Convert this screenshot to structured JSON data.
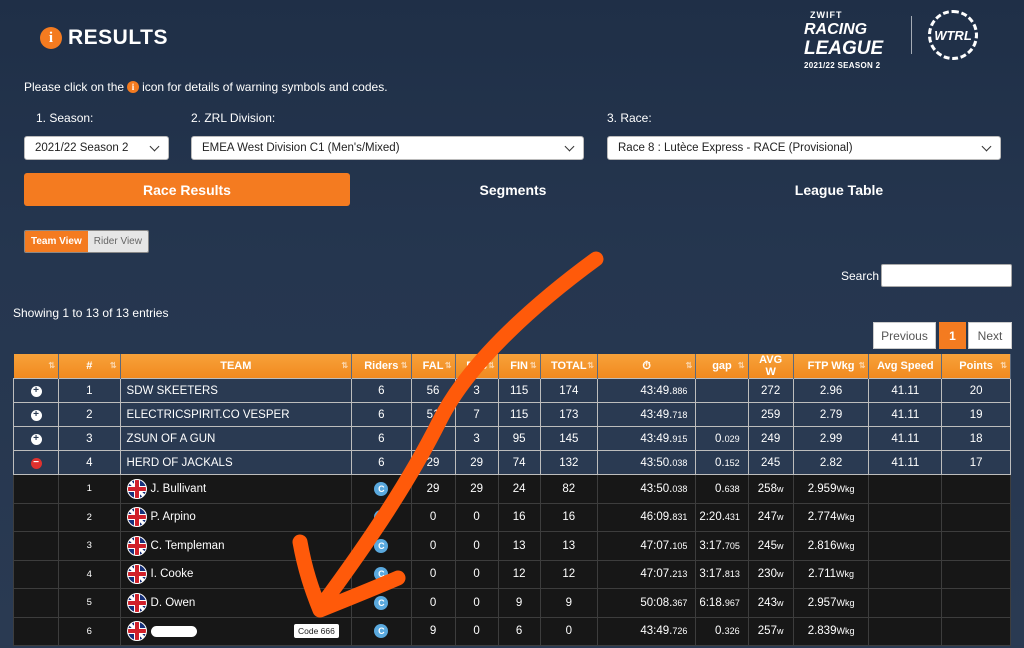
{
  "header": {
    "info_glyph": "i",
    "title": "RESULTS",
    "logo": {
      "line1": "ZWIFT",
      "line2": "RACING",
      "line3": "LEAGUE",
      "line4": "2021/22 SEASON 2"
    },
    "wtrl": "WTRL"
  },
  "notice": {
    "pre": "Please click on the",
    "post": "icon for details of warning symbols and codes."
  },
  "filters": {
    "season": {
      "label": "1. Season:",
      "value": "2021/22 Season 2"
    },
    "division": {
      "label": "2. ZRL Division:",
      "value": "EMEA West Division C1 (Men's/Mixed)"
    },
    "race": {
      "label": "3. Race:",
      "value": "Race 8 : Lutèce Express - RACE (Provisional)"
    }
  },
  "tabs": [
    "Race Results",
    "Segments",
    "League Table"
  ],
  "view": {
    "team": "Team View",
    "rider": "Rider View"
  },
  "search": {
    "label": "Search"
  },
  "showing": "Showing 1 to 13 of 13 entries",
  "pagination": {
    "previous": "Previous",
    "page": "1",
    "next": "Next"
  },
  "columns": [
    "#",
    "TEAM",
    "Riders",
    "FAL",
    "FTS",
    "FIN",
    "TOTAL",
    "⏱",
    "gap",
    "AVG W",
    "FTP Wkg",
    "Avg Speed",
    "Points"
  ],
  "teams": [
    {
      "rank": "1",
      "name": "SDW SKEETERS",
      "riders": "6",
      "fal": "56",
      "fts": "3",
      "fin": "115",
      "total": "174",
      "time": "43:49.",
      "ms": "886",
      "gap": "",
      "gap_ms": "",
      "avgw": "272",
      "ftp": "2.96",
      "speed": "41.11",
      "points": "20",
      "ctrl": "+"
    },
    {
      "rank": "2",
      "name": "ELECTRICSPIRIT.CO VESPER",
      "riders": "6",
      "fal": "51",
      "fts": "7",
      "fin": "115",
      "total": "173",
      "time": "43:49.",
      "ms": "718",
      "gap": "",
      "gap_ms": "",
      "avgw": "259",
      "ftp": "2.79",
      "speed": "41.11",
      "points": "19",
      "ctrl": "+"
    },
    {
      "rank": "3",
      "name": "ZSUN OF A GUN",
      "riders": "6",
      "fal": "47",
      "fts": "3",
      "fin": "95",
      "total": "145",
      "time": "43:49.",
      "ms": "915",
      "gap": "0.",
      "gap_ms": "029",
      "avgw": "249",
      "ftp": "2.99",
      "speed": "41.11",
      "points": "18",
      "ctrl": "+"
    },
    {
      "rank": "4",
      "name": "HERD OF JACKALS",
      "riders": "6",
      "fal": "29",
      "fts": "29",
      "fin": "74",
      "total": "132",
      "time": "43:50.",
      "ms": "038",
      "gap": "0.",
      "gap_ms": "152",
      "avgw": "245",
      "ftp": "2.82",
      "speed": "41.11",
      "points": "17",
      "ctrl": "−"
    }
  ],
  "riders": [
    {
      "rank": "1",
      "name": "J. Bullivant",
      "cat": "C",
      "fal": "29",
      "fts": "29",
      "fin": "24",
      "total": "82",
      "time": "43:50.",
      "ms": "038",
      "gap": "0.",
      "gap_ms": "638",
      "avgw": "258",
      "w": "w",
      "ftp": "2.959",
      "wkg": "Wkg"
    },
    {
      "rank": "2",
      "name": "P. Arpino",
      "cat": "C",
      "fal": "0",
      "fts": "0",
      "fin": "16",
      "total": "16",
      "time": "46:09.",
      "ms": "831",
      "gap": "2:20.",
      "gap_ms": "431",
      "avgw": "247",
      "w": "w",
      "ftp": "2.774",
      "wkg": "Wkg"
    },
    {
      "rank": "3",
      "name": "C. Templeman",
      "cat": "C",
      "fal": "0",
      "fts": "0",
      "fin": "13",
      "total": "13",
      "time": "47:07.",
      "ms": "105",
      "gap": "3:17.",
      "gap_ms": "705",
      "avgw": "245",
      "w": "w",
      "ftp": "2.816",
      "wkg": "Wkg"
    },
    {
      "rank": "4",
      "name": "I. Cooke",
      "cat": "C",
      "fal": "0",
      "fts": "0",
      "fin": "12",
      "total": "12",
      "time": "47:07.",
      "ms": "213",
      "gap": "3:17.",
      "gap_ms": "813",
      "avgw": "230",
      "w": "w",
      "ftp": "2.711",
      "wkg": "Wkg"
    },
    {
      "rank": "5",
      "name": "D. Owen",
      "cat": "C",
      "fal": "0",
      "fts": "0",
      "fin": "9",
      "total": "9",
      "time": "50:08.",
      "ms": "367",
      "gap": "6:18.",
      "gap_ms": "967",
      "avgw": "243",
      "w": "w",
      "ftp": "2.957",
      "wkg": "Wkg"
    },
    {
      "rank": "6",
      "name": "",
      "cat": "C",
      "fal": "9",
      "fts": "0",
      "fin": "6",
      "total": "0",
      "time": "43:49.",
      "ms": "726",
      "gap": "0.",
      "gap_ms": "326",
      "avgw": "257",
      "w": "w",
      "ftp": "2.839",
      "wkg": "Wkg"
    }
  ],
  "code_badge": "Code 666",
  "colors": {
    "accent": "#f47b20",
    "bg": "#25364f",
    "rider_row": "#171717",
    "warn": "#e0322f"
  }
}
